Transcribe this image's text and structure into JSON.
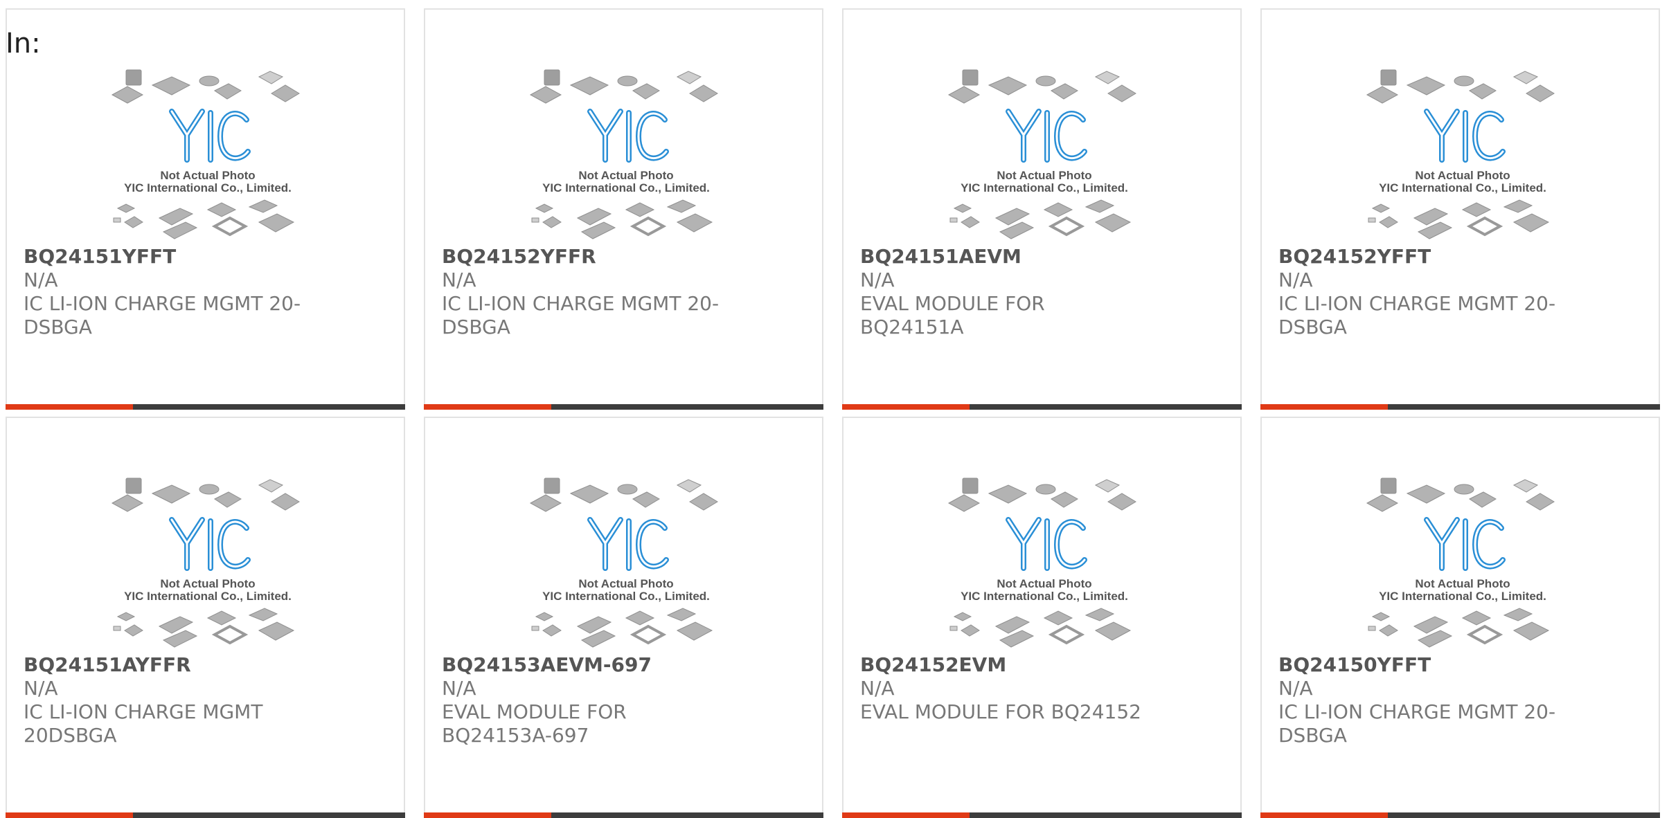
{
  "header": {
    "label": "In:"
  },
  "thumbnail": {
    "caption_line1": "Not Actual Photo",
    "caption_line2": "YIC International Co., Limited.",
    "logo_text": "YIC",
    "icon": "chip-packages-placeholder-icon"
  },
  "colors": {
    "accent": "#e03a16",
    "bar": "#3d3d3d",
    "logo": "#2a8fd6",
    "chip": "#b0b0b0"
  },
  "products": [
    {
      "part_number": "BQ24151YFFT",
      "manufacturer": "N/A",
      "description": "IC LI-ION CHARGE MGMT 20-DSBGA"
    },
    {
      "part_number": "BQ24152YFFR",
      "manufacturer": "N/A",
      "description": "IC LI-ION CHARGE MGMT 20-DSBGA"
    },
    {
      "part_number": "BQ24151AEVM",
      "manufacturer": "N/A",
      "description": "EVAL MODULE FOR BQ24151A"
    },
    {
      "part_number": "BQ24152YFFT",
      "manufacturer": "N/A",
      "description": "IC LI-ION CHARGE MGMT 20-DSBGA"
    },
    {
      "part_number": "BQ24151AYFFR",
      "manufacturer": "N/A",
      "description": "IC LI-ION CHARGE MGMT 20DSBGA"
    },
    {
      "part_number": "BQ24153AEVM-697",
      "manufacturer": "N/A",
      "description": "EVAL MODULE FOR BQ24153A-697"
    },
    {
      "part_number": "BQ24152EVM",
      "manufacturer": "N/A",
      "description": "EVAL MODULE FOR BQ24152"
    },
    {
      "part_number": "BQ24150YFFT",
      "manufacturer": "N/A",
      "description": "IC LI-ION CHARGE MGMT 20-DSBGA"
    }
  ]
}
